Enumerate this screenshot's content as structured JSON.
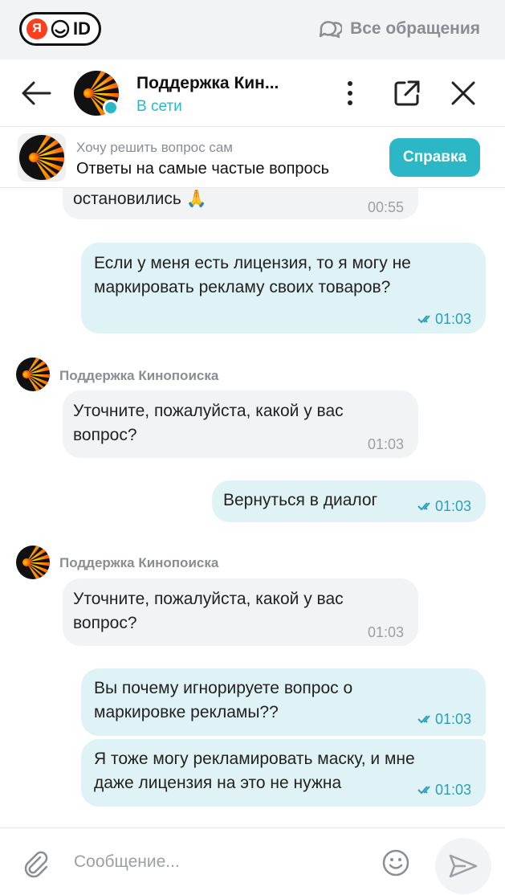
{
  "topbar": {
    "logo_ya": "Я",
    "logo_id": "ID",
    "all_requests": "Все обращения"
  },
  "header": {
    "title": "Поддержка Кин...",
    "status": "В сети"
  },
  "banner": {
    "subtitle": "Хочу решить вопрос сам",
    "text": "Ответы на самые частые вопрось",
    "button": "Справка"
  },
  "messages": [
    {
      "dir": "in",
      "text": "остановились 🙏",
      "time": "00:55"
    },
    {
      "dir": "out",
      "lines": [
        "Если у меня есть лицензия, то я могу не",
        "маркировать рекламу своих товаров?"
      ],
      "time": "01:03"
    },
    {
      "dir": "in",
      "sender": "Поддержка Кинопоиска",
      "lines": [
        "Уточните, пожалуйста, какой у вас",
        "вопрос?"
      ],
      "time": "01:03"
    },
    {
      "dir": "out",
      "text": "Вернуться в диалог",
      "time": "01:03"
    },
    {
      "dir": "in",
      "sender": "Поддержка Кинопоиска",
      "lines": [
        "Уточните, пожалуйста, какой у вас",
        "вопрос?"
      ],
      "time": "01:03"
    },
    {
      "dir": "out",
      "lines": [
        "Вы почему игнорируете вопрос о",
        "маркировке рекламы??"
      ],
      "time": "01:03"
    },
    {
      "dir": "out",
      "lines": [
        "Я тоже могу рекламировать маску, и мне",
        "даже лицензия на это не нужна"
      ],
      "time": "01:03"
    }
  ],
  "input": {
    "placeholder": "Сообщение..."
  },
  "colors": {
    "accent": "#2bb7c6",
    "incoming_bubble": "#f2f3f5",
    "outgoing_bubble": "#dff3f7",
    "brand_orange": "#ff6a00"
  }
}
